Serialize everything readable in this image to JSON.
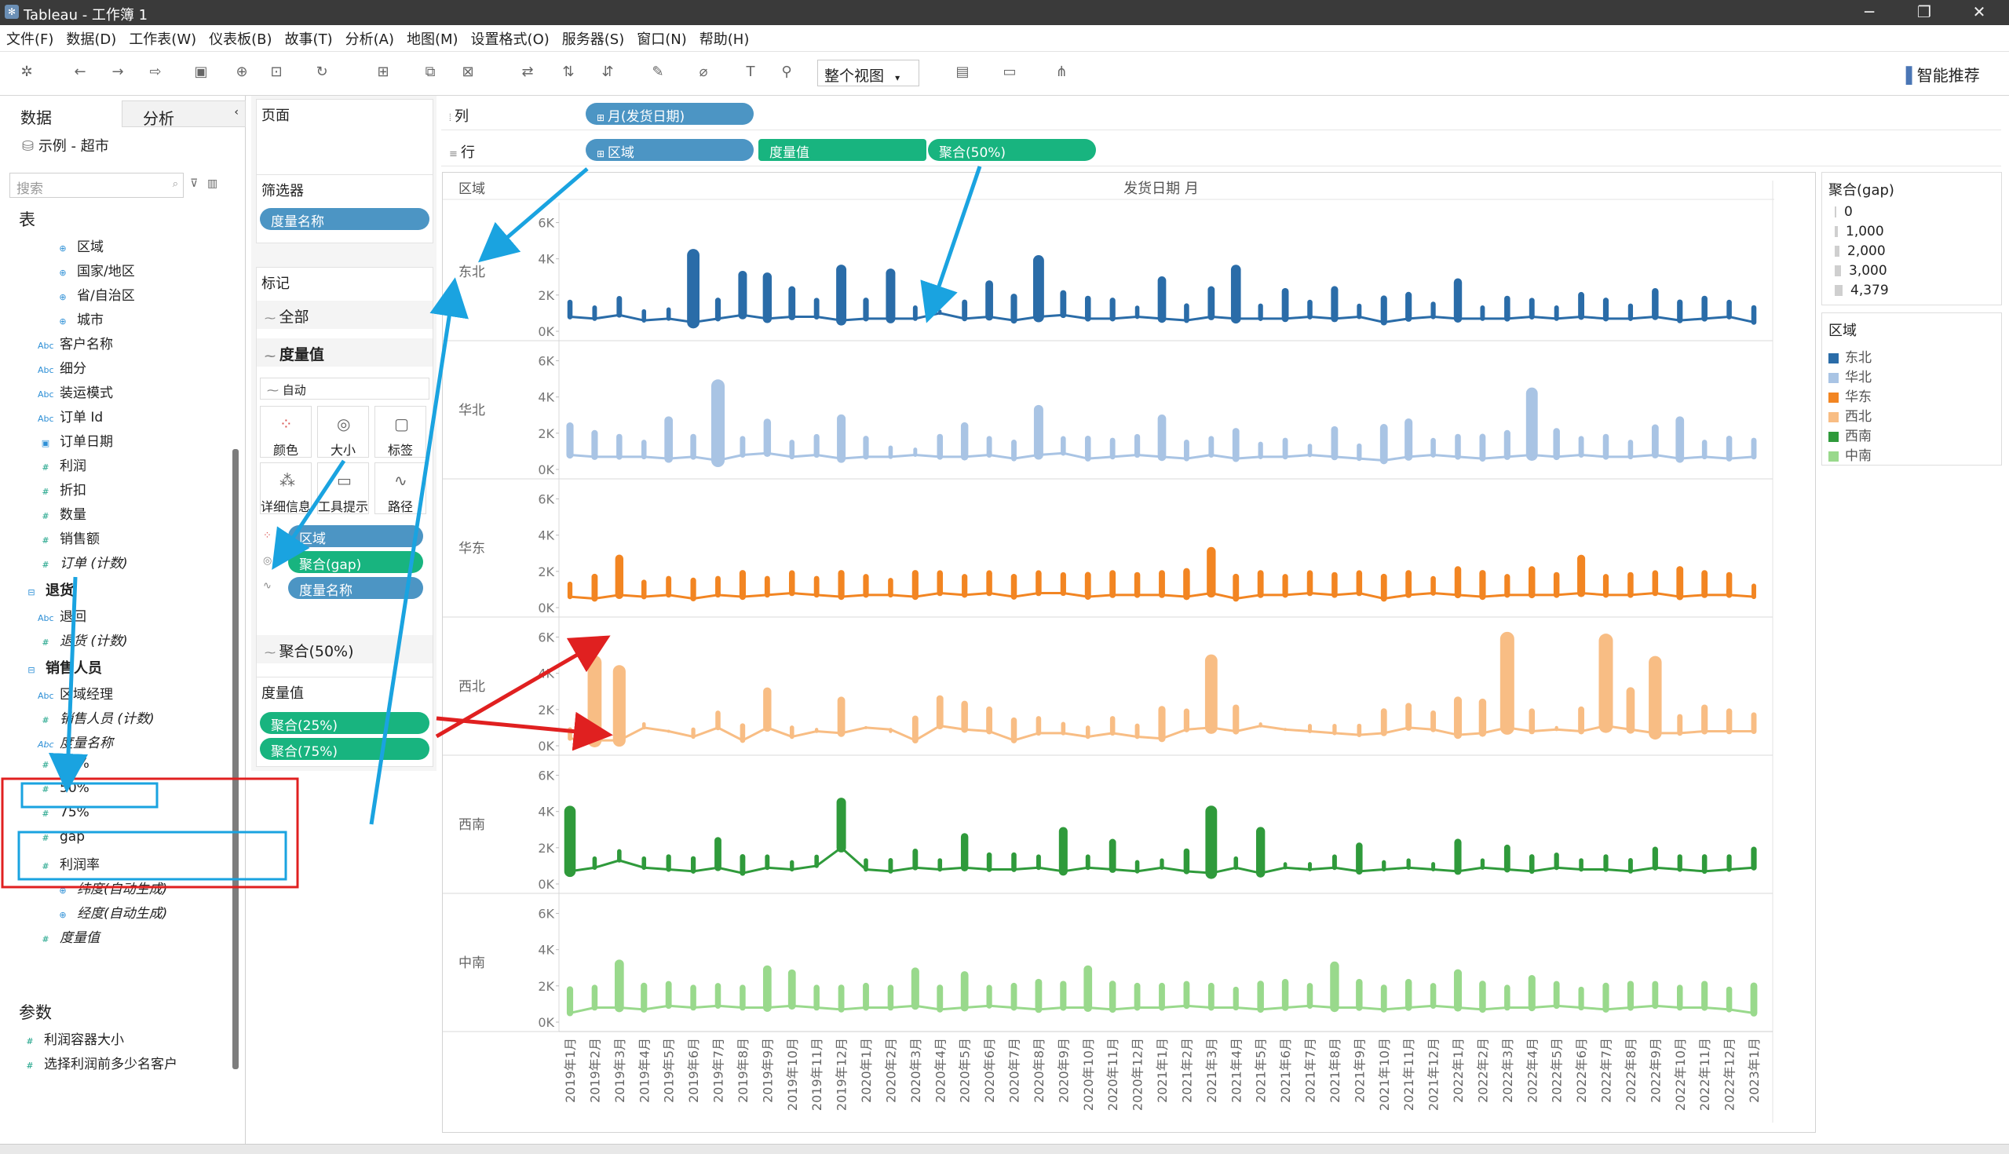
{
  "window": {
    "title": "Tableau - 工作簿 1",
    "min": "─",
    "max": "❐",
    "close": "✕"
  },
  "menu": [
    "文件(F)",
    "数据(D)",
    "工作表(W)",
    "仪表板(B)",
    "故事(T)",
    "分析(A)",
    "地图(M)",
    "设置格式(O)",
    "服务器(S)",
    "窗口(N)",
    "帮助(H)"
  ],
  "toolbar": {
    "view_mode": "整个视图",
    "smart": "智能推荐"
  },
  "left": {
    "tab_data": "数据",
    "tab_analysis": "分析",
    "datasource": "示例 - 超市",
    "search_placeholder": "搜索",
    "section_table": "表",
    "section_params": "参数",
    "fields": [
      {
        "t": "geo",
        "name": "区域"
      },
      {
        "t": "geo",
        "name": "国家/地区"
      },
      {
        "t": "geo",
        "name": "省/自治区"
      },
      {
        "t": "geo",
        "name": "城市"
      },
      {
        "t": "abc",
        "name": "客户名称"
      },
      {
        "t": "abc",
        "name": "细分"
      },
      {
        "t": "abc",
        "name": "装运模式"
      },
      {
        "t": "abc",
        "name": "订单 Id"
      },
      {
        "t": "date",
        "name": "订单日期"
      },
      {
        "t": "num",
        "name": "利润"
      },
      {
        "t": "num",
        "name": "折扣"
      },
      {
        "t": "num",
        "name": "数量"
      },
      {
        "t": "num",
        "name": "销售额"
      },
      {
        "t": "num",
        "name": "订单 (计数)",
        "it": true
      },
      {
        "t": "grp",
        "name": "退货"
      },
      {
        "t": "abc",
        "name": "退回"
      },
      {
        "t": "num",
        "name": "退货 (计数)",
        "it": true
      },
      {
        "t": "grp",
        "name": "销售人员"
      },
      {
        "t": "abc",
        "name": "区域经理"
      },
      {
        "t": "num",
        "name": "销售人员 (计数)",
        "it": true
      },
      {
        "t": "abc",
        "name": "度量名称",
        "it": true
      },
      {
        "t": "num",
        "name": "25%"
      },
      {
        "t": "num",
        "name": "50%"
      },
      {
        "t": "num",
        "name": "75%"
      },
      {
        "t": "num",
        "name": "gap"
      },
      {
        "t": "num",
        "name": "利润率"
      },
      {
        "t": "geo",
        "name": "纬度(自动生成)",
        "it": true
      },
      {
        "t": "geo",
        "name": "经度(自动生成)",
        "it": true
      },
      {
        "t": "num",
        "name": "度量值",
        "it": true
      }
    ],
    "params": [
      "利润容器大小",
      "选择利润前多少名客户"
    ]
  },
  "shelves": {
    "pages": "页面",
    "filters": "筛选器",
    "filter_pill": "度量名称",
    "marks": "标记",
    "marks_all": "全部",
    "marks_mv": "度量值",
    "mark_type": "自动",
    "mark_buttons": [
      "颜色",
      "大小",
      "标签",
      "详细信息",
      "工具提示",
      "路径"
    ],
    "mark_pills": [
      "区域",
      "聚合(gap)",
      "度量名称"
    ],
    "marks_50": "聚合(50%)",
    "mv_title": "度量值",
    "mv_pills": [
      "聚合(25%)",
      "聚合(75%)"
    ],
    "columns_label": "列",
    "rows_label": "行",
    "col_pills": [
      "月(发货日期)"
    ],
    "row_pills": [
      "区域",
      "度量值",
      "聚合(50%)"
    ]
  },
  "legend_gap": {
    "title": "聚合(gap)",
    "items": [
      "0",
      "1,000",
      "2,000",
      "3,000",
      "4,379"
    ]
  },
  "legend_region": {
    "title": "区域",
    "items": [
      {
        "name": "东北",
        "color": "#2a6ca8"
      },
      {
        "name": "华北",
        "color": "#a9c4e4"
      },
      {
        "name": "华东",
        "color": "#f28522"
      },
      {
        "name": "西北",
        "color": "#f8bd84"
      },
      {
        "name": "西南",
        "color": "#2f9a3b"
      },
      {
        "name": "中南",
        "color": "#99d98c"
      }
    ]
  },
  "chart_data": {
    "type": "line",
    "title": "发货日期 月",
    "row_header": "区域",
    "x": [
      "2019年1月",
      "2019年2月",
      "2019年3月",
      "2019年4月",
      "2019年5月",
      "2019年6月",
      "2019年7月",
      "2019年8月",
      "2019年9月",
      "2019年10月",
      "2019年11月",
      "2019年12月",
      "2020年1月",
      "2020年2月",
      "2020年3月",
      "2020年4月",
      "2020年5月",
      "2020年6月",
      "2020年7月",
      "2020年8月",
      "2020年9月",
      "2020年10月",
      "2020年11月",
      "2020年12月",
      "2021年1月",
      "2021年2月",
      "2021年3月",
      "2021年4月",
      "2021年5月",
      "2021年6月",
      "2021年7月",
      "2021年8月",
      "2021年9月",
      "2021年10月",
      "2021年11月",
      "2021年12月",
      "2022年1月",
      "2022年2月",
      "2022年3月",
      "2022年4月",
      "2022年5月",
      "2022年6月",
      "2022年7月",
      "2022年8月",
      "2022年9月",
      "2022年10月",
      "2022年11月",
      "2022年12月",
      "2023年1月"
    ],
    "y_ticks": [
      "0K",
      "2K",
      "4K",
      "6K"
    ],
    "ylim": [
      0,
      6500
    ],
    "series": [
      {
        "name": "东北",
        "color": "#2a6ca8",
        "p25": [
          800,
          700,
          900,
          600,
          700,
          500,
          700,
          900,
          700,
          800,
          800,
          600,
          700,
          700,
          700,
          1000,
          700,
          800,
          600,
          800,
          900,
          700,
          700,
          800,
          700,
          600,
          800,
          700,
          700,
          700,
          800,
          700,
          800,
          500,
          700,
          800,
          700,
          700,
          700,
          800,
          700,
          800,
          700,
          700,
          800,
          600,
          700,
          800,
          500
        ],
        "p75": [
          1600,
          1300,
          1800,
          1100,
          1200,
          4200,
          1700,
          3100,
          3000,
          2300,
          1700,
          3400,
          1700,
          3200,
          1300,
          1100,
          1600,
          2600,
          1900,
          3900,
          2100,
          1800,
          1700,
          1300,
          2800,
          1400,
          2300,
          3400,
          1400,
          2200,
          1600,
          2300,
          1400,
          1800,
          2000,
          1500,
          2700,
          1300,
          1800,
          1700,
          1300,
          2000,
          1700,
          1400,
          2200,
          1600,
          1800,
          1600,
          1300
        ]
      },
      {
        "name": "华北",
        "color": "#a9c4e4",
        "p25": [
          800,
          700,
          700,
          700,
          600,
          700,
          500,
          800,
          900,
          700,
          800,
          600,
          700,
          700,
          800,
          700,
          700,
          800,
          600,
          800,
          900,
          600,
          700,
          800,
          700,
          600,
          800,
          600,
          700,
          700,
          800,
          700,
          600,
          500,
          700,
          800,
          700,
          600,
          700,
          800,
          700,
          800,
          700,
          700,
          800,
          600,
          700,
          600,
          700
        ],
        "p75": [
          2400,
          2000,
          1800,
          1500,
          2700,
          1800,
          4600,
          1700,
          2600,
          1500,
          1800,
          2800,
          1700,
          1200,
          1100,
          1800,
          2400,
          1700,
          1500,
          3300,
          1700,
          1700,
          1600,
          1800,
          2800,
          1500,
          1700,
          2100,
          1400,
          1600,
          1300,
          2200,
          1300,
          2300,
          2600,
          1600,
          1800,
          1800,
          2000,
          4200,
          2100,
          1700,
          1800,
          1500,
          2300,
          2700,
          1500,
          1700,
          1600
        ]
      },
      {
        "name": "华东",
        "color": "#f28522",
        "p25": [
          600,
          500,
          700,
          600,
          700,
          500,
          700,
          600,
          700,
          800,
          700,
          600,
          700,
          700,
          600,
          800,
          700,
          800,
          600,
          800,
          800,
          600,
          700,
          700,
          700,
          600,
          800,
          500,
          700,
          700,
          800,
          700,
          800,
          500,
          700,
          800,
          700,
          600,
          700,
          700,
          700,
          800,
          700,
          700,
          800,
          600,
          700,
          700,
          600
        ],
        "p75": [
          1300,
          1700,
          2700,
          1400,
          1600,
          1500,
          1600,
          1900,
          1600,
          1900,
          1600,
          1900,
          1700,
          1500,
          1900,
          1900,
          1700,
          1900,
          1700,
          1900,
          1800,
          1800,
          1900,
          1800,
          1900,
          2000,
          3100,
          1700,
          1900,
          1700,
          1900,
          1800,
          1900,
          1700,
          1900,
          1600,
          2100,
          1900,
          1700,
          2100,
          1800,
          2700,
          1700,
          1800,
          1900,
          2100,
          1900,
          1800,
          1200
        ]
      },
      {
        "name": "西北",
        "color": "#f8bd84",
        "p25": [
          400,
          300,
          300,
          1000,
          800,
          500,
          1000,
          300,
          1000,
          500,
          800,
          700,
          1000,
          900,
          300,
          1100,
          900,
          800,
          300,
          700,
          700,
          500,
          700,
          500,
          400,
          900,
          1000,
          800,
          1100,
          900,
          800,
          700,
          600,
          700,
          1000,
          900,
          600,
          700,
          1000,
          800,
          900,
          800,
          1100,
          900,
          700,
          700,
          800,
          800,
          800
        ],
        "p75": [
          900,
          4600,
          4100,
          1200,
          800,
          900,
          1800,
          1100,
          3000,
          1000,
          900,
          2500,
          1000,
          800,
          1500,
          2600,
          2300,
          2000,
          1400,
          1500,
          1200,
          1000,
          1500,
          1100,
          2000,
          1900,
          4700,
          2100,
          1200,
          900,
          1100,
          1100,
          1100,
          1900,
          2200,
          1800,
          2500,
          2400,
          5900,
          1900,
          1000,
          2000,
          5800,
          3000,
          4600,
          1600,
          2100,
          1900,
          1700
        ]
      },
      {
        "name": "西南",
        "color": "#2f9a3b",
        "p25": [
          700,
          900,
          1300,
          900,
          800,
          700,
          900,
          600,
          900,
          800,
          1000,
          2000,
          800,
          700,
          900,
          800,
          900,
          800,
          800,
          900,
          700,
          900,
          800,
          700,
          900,
          700,
          600,
          900,
          600,
          900,
          800,
          900,
          700,
          800,
          900,
          800,
          700,
          900,
          800,
          700,
          900,
          800,
          800,
          700,
          900,
          800,
          700,
          800,
          900
        ],
        "p75": [
          4000,
          1400,
          1800,
          1400,
          1500,
          1400,
          2400,
          1500,
          1500,
          1200,
          1500,
          4500,
          1300,
          1300,
          1800,
          1300,
          2600,
          1600,
          1600,
          1500,
          2900,
          1500,
          2300,
          1200,
          1300,
          1800,
          4000,
          1400,
          2900,
          1100,
          1100,
          1500,
          2100,
          1200,
          1300,
          1100,
          2300,
          1300,
          2000,
          1500,
          1600,
          1300,
          1500,
          1300,
          1900,
          1500,
          1500,
          1500,
          1900
        ]
      },
      {
        "name": "中南",
        "color": "#99d98c",
        "p25": [
          500,
          800,
          800,
          700,
          900,
          800,
          900,
          800,
          800,
          900,
          800,
          700,
          800,
          800,
          900,
          700,
          800,
          900,
          800,
          700,
          800,
          800,
          700,
          800,
          800,
          900,
          800,
          800,
          700,
          800,
          900,
          800,
          800,
          700,
          800,
          900,
          800,
          700,
          800,
          800,
          900,
          800,
          700,
          800,
          900,
          800,
          800,
          700,
          500
        ],
        "p75": [
          1800,
          1900,
          3200,
          2000,
          2100,
          1900,
          2000,
          1900,
          2900,
          2700,
          1900,
          1900,
          2000,
          1900,
          2800,
          1900,
          2600,
          1900,
          2000,
          2200,
          2100,
          2900,
          2100,
          2000,
          2000,
          2100,
          2000,
          1800,
          2100,
          2200,
          2000,
          3100,
          2200,
          1900,
          2200,
          2000,
          2700,
          2100,
          1900,
          2400,
          2100,
          1800,
          2000,
          2100,
          2100,
          1900,
          2100,
          1800,
          2000
        ]
      }
    ]
  }
}
